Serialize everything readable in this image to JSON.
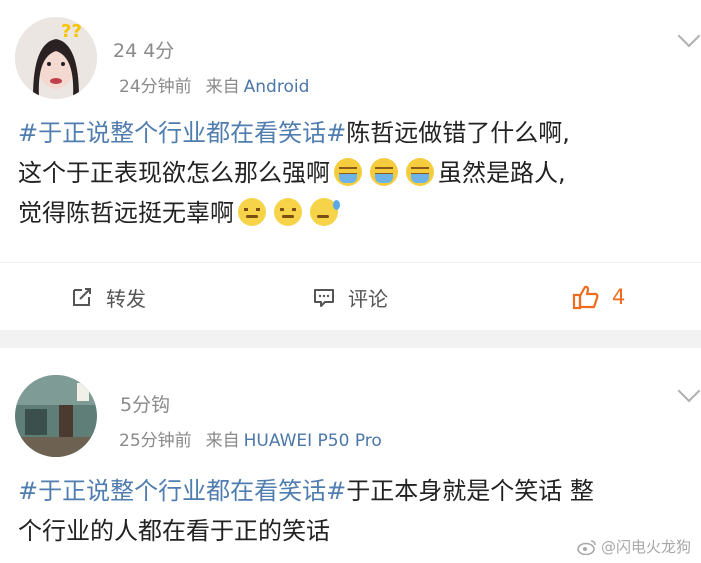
{
  "post1": {
    "username": "24 4分",
    "time": "24分钟前",
    "source_prefix": "来自",
    "device": "Android",
    "hashtag": "#于正说整个行业都在看笑话#",
    "line1_rest": "陈哲远做错了什么啊,",
    "line2": "这个于正表现欲怎么那么强啊",
    "line2_after_emoji": "虽然是路人,",
    "line3": "觉得陈哲远挺无辜啊",
    "actions": {
      "repost_label": "转发",
      "comment_label": "评论",
      "like_count": "4"
    }
  },
  "post2": {
    "username": "5分钩",
    "time": "25分钟前",
    "source_prefix": "来自",
    "device": "HUAWEI P50 Pro",
    "hashtag": "#于正说整个行业都在看笑话#",
    "line1_rest": "于正本身就是个笑话 整",
    "line2": "个行业的人都在看于正的笑话"
  },
  "watermark": "@闪电火龙狗",
  "colors": {
    "link": "#507daf",
    "like": "#f06c1d",
    "meta": "#8a8a8a"
  },
  "icons": [
    "repost-icon",
    "comment-icon",
    "like-icon",
    "chevron-down-icon",
    "weibo-icon"
  ]
}
